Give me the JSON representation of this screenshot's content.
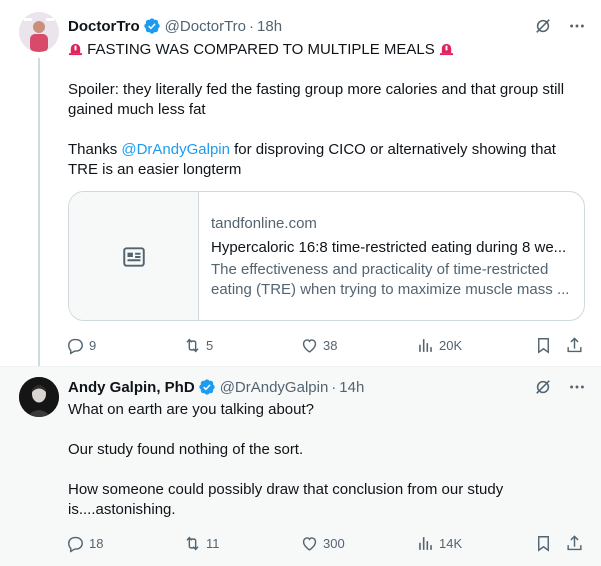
{
  "tweet1": {
    "author": {
      "name": "DoctorTro",
      "handle": "@DoctorTro",
      "separator": "·",
      "time": "18h"
    },
    "headline": "FASTING WAS COMPARED TO MULTIPLE MEALS",
    "para1": "Spoiler: they literally fed the fasting group more calories and that group still gained much less fat",
    "para2_before": "Thanks ",
    "para2_mention": "@DrAndyGalpin",
    "para2_after": " for disproving CICO or alternatively showing that TRE is an easier longterm",
    "card": {
      "domain": "tandfonline.com",
      "title": "Hypercaloric 16:8 time-restricted eating during 8 we...",
      "description": "The effectiveness and practicality of time-restricted eating (TRE) when trying to maximize muscle mass ..."
    },
    "stats": {
      "replies": "9",
      "retweets": "5",
      "likes": "38",
      "views": "20K"
    }
  },
  "tweet2": {
    "author": {
      "name": "Andy Galpin, PhD",
      "handle": "@DrAndyGalpin",
      "separator": "·",
      "time": "14h"
    },
    "line1": "What on earth are you talking about?",
    "line2": "Our study found nothing of the sort.",
    "line3": "How someone could possibly draw that conclusion from our study is....astonishing.",
    "stats": {
      "replies": "18",
      "retweets": "11",
      "likes": "300",
      "views": "14K"
    }
  },
  "colors": {
    "accent": "#1d9bf0",
    "muted": "#536471",
    "text": "#0f1419",
    "siren": "#e0245e"
  },
  "icons": [
    "verified-badge-icon",
    "grok-icon",
    "more-icon",
    "siren-icon",
    "article-icon",
    "reply-icon",
    "retweet-icon",
    "like-icon",
    "views-icon",
    "bookmark-icon",
    "share-icon"
  ]
}
